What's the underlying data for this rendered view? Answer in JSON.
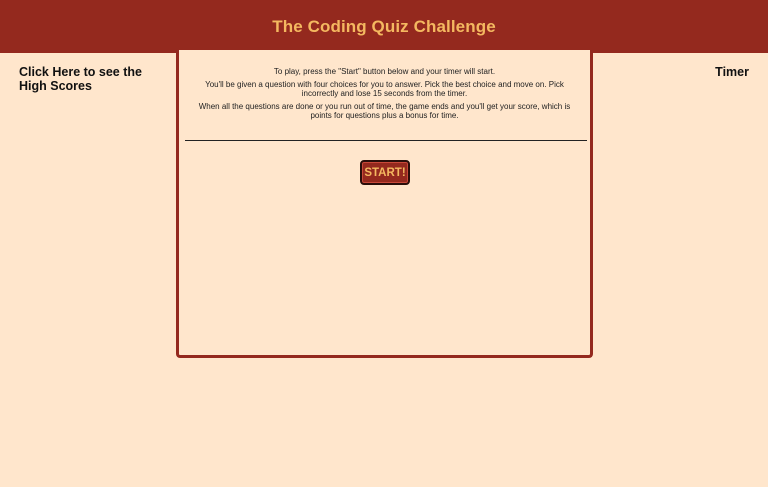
{
  "header": {
    "title": "The Coding Quiz Challenge"
  },
  "nav": {
    "highscores_link": "Click Here to see the High Scores",
    "timer_label": "Timer"
  },
  "quiz": {
    "instructions": [
      "To play, press the \"Start\" button below and your timer will start.",
      "You'll be given a question with four choices for you to answer. Pick the best choice and move on. Pick incorrectly and lose 15 seconds from the timer.",
      "When all the questions are done or you run out of time, the game ends and you'll get your score, which is points for questions plus a bonus for time."
    ],
    "start_label": "START!"
  },
  "colors": {
    "background": "#ffe6cc",
    "brand": "#94291e",
    "accent_text": "#f4b860"
  }
}
